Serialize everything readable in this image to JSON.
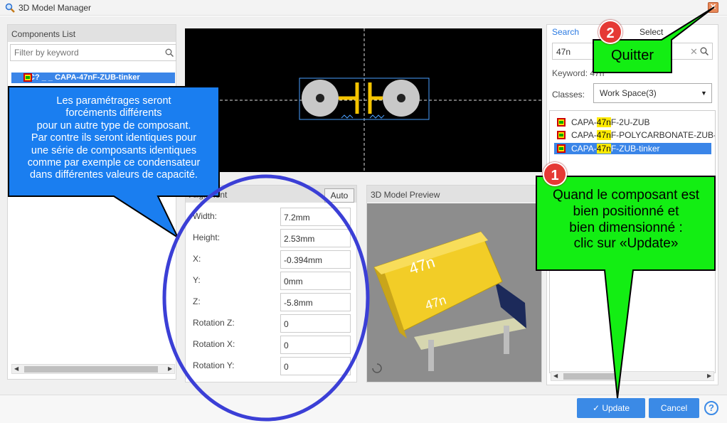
{
  "window": {
    "title": "3D Model Manager"
  },
  "components_panel": {
    "title": "Components List",
    "filter_placeholder": "Filter by keyword",
    "selected_item": "C? _ _ CAPA-47nF-ZUB-tinker"
  },
  "alignment": {
    "title": "Alignment",
    "auto_label": "Auto",
    "fields": [
      {
        "label": "Width:",
        "value": "7.2mm"
      },
      {
        "label": "Height:",
        "value": "2.53mm"
      },
      {
        "label": "X:",
        "value": "-0.394mm"
      },
      {
        "label": "Y:",
        "value": "0mm"
      },
      {
        "label": "Z:",
        "value": "-5.8mm"
      },
      {
        "label": "Rotation Z:",
        "value": "0"
      },
      {
        "label": "Rotation X:",
        "value": "0"
      },
      {
        "label": "Rotation Y:",
        "value": "0"
      }
    ]
  },
  "preview": {
    "title": "3D Model Preview",
    "top_label": "47n",
    "front_label": "47n"
  },
  "search_panel": {
    "tab_search": "Search",
    "tab_select": "Select",
    "query": "47n",
    "keyword_line": "Keyword: 47n",
    "classes_label": "Classes:",
    "classes_value": "Work Space(3)",
    "results": [
      {
        "pre": "CAPA-",
        "hit": "47n",
        "post": "F-2U-ZUB",
        "selected": false
      },
      {
        "pre": "CAPA-",
        "hit": "47n",
        "post": "F-POLYCARBONATE-ZUB-",
        "selected": false
      },
      {
        "pre": "CAPA-",
        "hit": "47n",
        "post": "F-ZUB-tinker",
        "selected": true
      }
    ]
  },
  "footer": {
    "update_label": "Update",
    "cancel_label": "Cancel",
    "help_label": "?"
  },
  "annotations": {
    "blue_note": [
      "Les paramétrages seront",
      "forcéments différents",
      "pour un autre type de composant.",
      "Par contre ils seront identiques pour",
      "une série de composants identiques",
      "comme par exemple ce condensateur",
      "dans différentes valeurs de capacité."
    ],
    "green_note_1": [
      "Quand le composant est",
      "bien positionné et",
      "bien dimensionné :",
      "clic sur «Update»"
    ],
    "green_note_2": "Quitter",
    "badge_1": "1",
    "badge_2": "2"
  },
  "colors": {
    "accent": "#3b8ae6",
    "selection": "#3a85e8",
    "callout_blue": "#1a7ef0",
    "callout_green": "#13ee13",
    "badge_red": "#e53935",
    "circle": "#3b3fd6"
  }
}
